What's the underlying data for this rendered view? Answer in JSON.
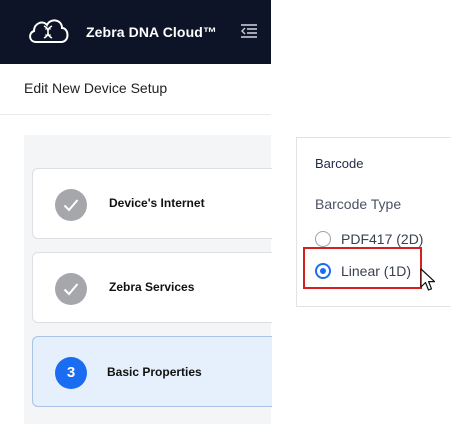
{
  "header": {
    "app_title": "Zebra DNA Cloud™",
    "logo_icon": "cloud-dna-icon",
    "menu_icon": "menu-collapse-icon",
    "background": "#0e1428"
  },
  "page": {
    "title": "Edit New Device Setup"
  },
  "steps": [
    {
      "label": "Device's Internet",
      "status": "completed",
      "icon": "check-icon"
    },
    {
      "label": "Zebra Services",
      "status": "completed",
      "icon": "check-icon"
    },
    {
      "label": "Basic Properties",
      "status": "active",
      "number": "3"
    }
  ],
  "barcode": {
    "title": "Barcode",
    "type_label": "Barcode Type",
    "options": [
      {
        "label": "PDF417 (2D)",
        "selected": false
      },
      {
        "label": "Linear (1D)",
        "selected": true
      }
    ]
  },
  "colors": {
    "accent": "#1a6df0",
    "completed_step": "#a5a7ab",
    "highlight": "#d62020"
  }
}
